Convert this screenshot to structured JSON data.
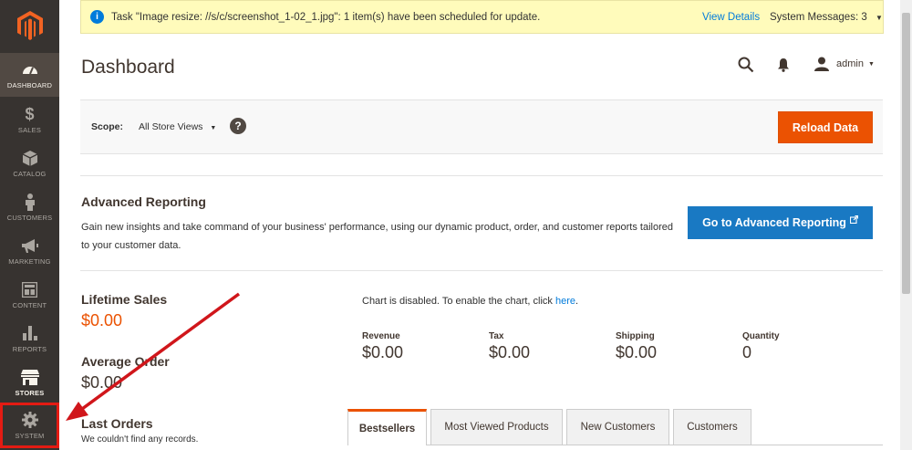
{
  "sidebar": {
    "items": [
      {
        "label": "DASHBOARD",
        "icon": "dashboard-icon"
      },
      {
        "label": "SALES",
        "icon": "dollar-icon"
      },
      {
        "label": "CATALOG",
        "icon": "box-icon"
      },
      {
        "label": "CUSTOMERS",
        "icon": "person-icon"
      },
      {
        "label": "MARKETING",
        "icon": "megaphone-icon"
      },
      {
        "label": "CONTENT",
        "icon": "layout-icon"
      },
      {
        "label": "REPORTS",
        "icon": "bar-chart-icon"
      },
      {
        "label": "STORES",
        "icon": "storefront-icon"
      },
      {
        "label": "SYSTEM",
        "icon": "gear-icon"
      }
    ]
  },
  "message": {
    "text": "Task \"Image resize: //s/c/screenshot_1-02_1.jpg\": 1 item(s) have been scheduled for update.",
    "view_details": "View Details",
    "system_messages": "System Messages: 3"
  },
  "header": {
    "title": "Dashboard",
    "user": "admin"
  },
  "scope": {
    "label": "Scope:",
    "value": "All Store Views",
    "reload_label": "Reload Data"
  },
  "advanced": {
    "title": "Advanced Reporting",
    "text": "Gain new insights and take command of your business' performance, using our dynamic product, order, and customer reports tailored to your customer data.",
    "button": "Go to Advanced Reporting"
  },
  "stats": {
    "lifetime_label": "Lifetime Sales",
    "lifetime_value": "$0.00",
    "average_label": "Average Order",
    "average_value": "$0.00",
    "last_orders_label": "Last Orders",
    "last_orders_empty": "We couldn't find any records."
  },
  "chart": {
    "disabled_text": "Chart is disabled. To enable the chart, click ",
    "link": "here",
    "period": "."
  },
  "totals": [
    {
      "label": "Revenue",
      "value": "$0.00"
    },
    {
      "label": "Tax",
      "value": "$0.00"
    },
    {
      "label": "Shipping",
      "value": "$0.00"
    },
    {
      "label": "Quantity",
      "value": "0"
    }
  ],
  "tabs": [
    "Bestsellers",
    "Most Viewed Products",
    "New Customers",
    "Customers"
  ],
  "colors": {
    "accent": "#eb5202",
    "link": "#007bdb",
    "sidebar": "#373330",
    "annotation": "#d0161b"
  }
}
